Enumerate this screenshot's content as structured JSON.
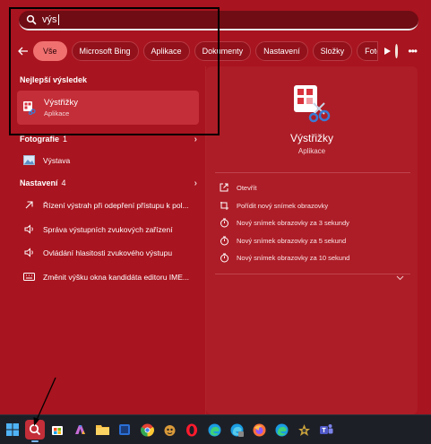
{
  "search": {
    "query": "výs"
  },
  "filters": {
    "items": [
      {
        "label": "Vše",
        "active": true
      },
      {
        "label": "Microsoft Bing",
        "active": false
      },
      {
        "label": "Aplikace",
        "active": false
      },
      {
        "label": "Dokumenty",
        "active": false
      },
      {
        "label": "Nastavení",
        "active": false
      },
      {
        "label": "Složky",
        "active": false
      },
      {
        "label": "Fotog",
        "active": false
      }
    ],
    "icons": [
      "back-arrow-icon",
      "play-more-icon",
      "account-avatar",
      "more-options-icon"
    ]
  },
  "results": {
    "best_match_heading": "Nejlepší výsledek",
    "best_match": {
      "title": "Výstřižky",
      "subtitle": "Aplikace",
      "icon": "snipping-tool-icon"
    },
    "photos": {
      "heading": "Fotografie",
      "count": "1",
      "items": [
        {
          "label": "Výstava",
          "icon": "photo-icon"
        }
      ]
    },
    "settings": {
      "heading": "Nastavení",
      "count": "4",
      "items": [
        {
          "label": "Řízení výstrah při odepření přístupu k pol...",
          "icon": "arrow-icon"
        },
        {
          "label": "Správa výstupních zvukových zařízení",
          "icon": "speaker-icon"
        },
        {
          "label": "Ovládání hlasitosti zvukového výstupu",
          "icon": "speaker-icon"
        },
        {
          "label": "Změnit výšku okna kandidáta editoru IME...",
          "icon": "keyboard-icon"
        }
      ]
    }
  },
  "detail": {
    "title": "Výstřižky",
    "subtitle": "Aplikace",
    "actions": [
      {
        "label": "Otevřít",
        "icon": "open-icon"
      },
      {
        "label": "Pořídit nový snímek obrazovky",
        "icon": "snip-icon"
      },
      {
        "label": "Nový snímek obrazovky za 3 sekundy",
        "icon": "timer-icon"
      },
      {
        "label": "Nový snímek obrazovky za 5 sekund",
        "icon": "timer-icon"
      },
      {
        "label": "Nový snímek obrazovky za 10 sekund",
        "icon": "timer-icon"
      }
    ]
  },
  "taskbar": {
    "items": [
      "start-icon",
      "search-icon",
      "store-icon",
      "copilot-icon",
      "file-explorer-icon",
      "app-icon",
      "chrome-icon",
      "app-icon",
      "opera-icon",
      "edge-icon",
      "edge-icon",
      "firefox-icon",
      "edge-icon",
      "app-icon",
      "teams-icon"
    ]
  },
  "colors": {
    "panel": "#a8141f",
    "chip_active": "#f07070",
    "taskbar": "#1d1f27"
  }
}
